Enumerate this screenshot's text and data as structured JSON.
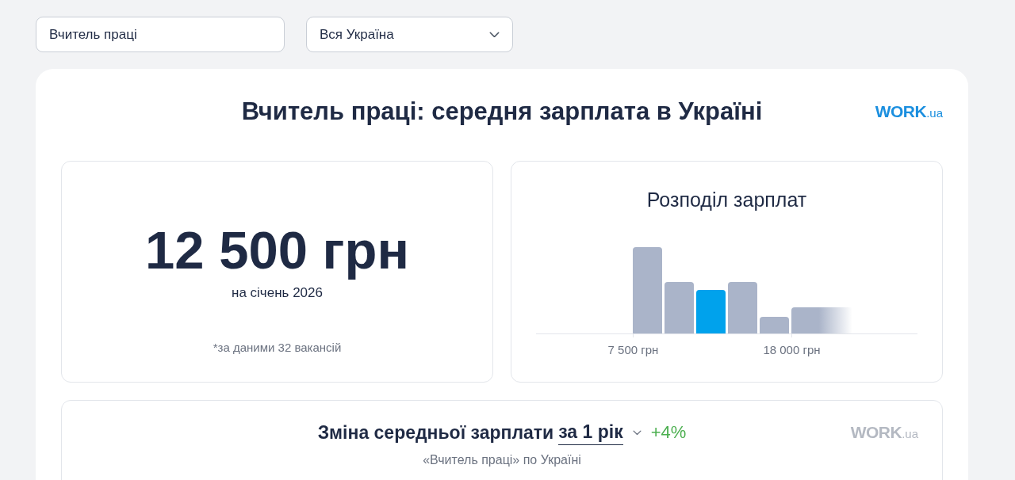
{
  "search": {
    "value": "Вчитель праці"
  },
  "region_select": {
    "value": "Вся Україна"
  },
  "report": {
    "title": "Вчитель праці: середня зарплата в Україні",
    "logo": {
      "name": "WORK",
      "suffix": ".ua",
      "muted": false
    }
  },
  "average": {
    "amount": "12 500 грн",
    "period": "на січень 2026",
    "note": "*за даними 32 вакансій"
  },
  "distribution": {
    "title": "Розподіл зарплат",
    "bars": [
      {
        "kind": "bin",
        "selected": false
      },
      {
        "kind": "bin",
        "selected": false
      },
      {
        "kind": "bin",
        "selected": true
      },
      {
        "kind": "bin",
        "selected": false
      },
      {
        "kind": "bin",
        "selected": false
      },
      {
        "kind": "tail",
        "selected": false
      }
    ],
    "tick_labels": [
      "7 500 грн",
      "18 000 грн"
    ]
  },
  "change": {
    "title": "Зміна середньої зарплати",
    "period_select": {
      "value": "за 1 рік"
    },
    "delta": "+4%",
    "subtitle": "«Вчитель праці» по Україні",
    "logo": {
      "name": "WORK",
      "suffix": ".ua",
      "muted": true
    }
  }
}
